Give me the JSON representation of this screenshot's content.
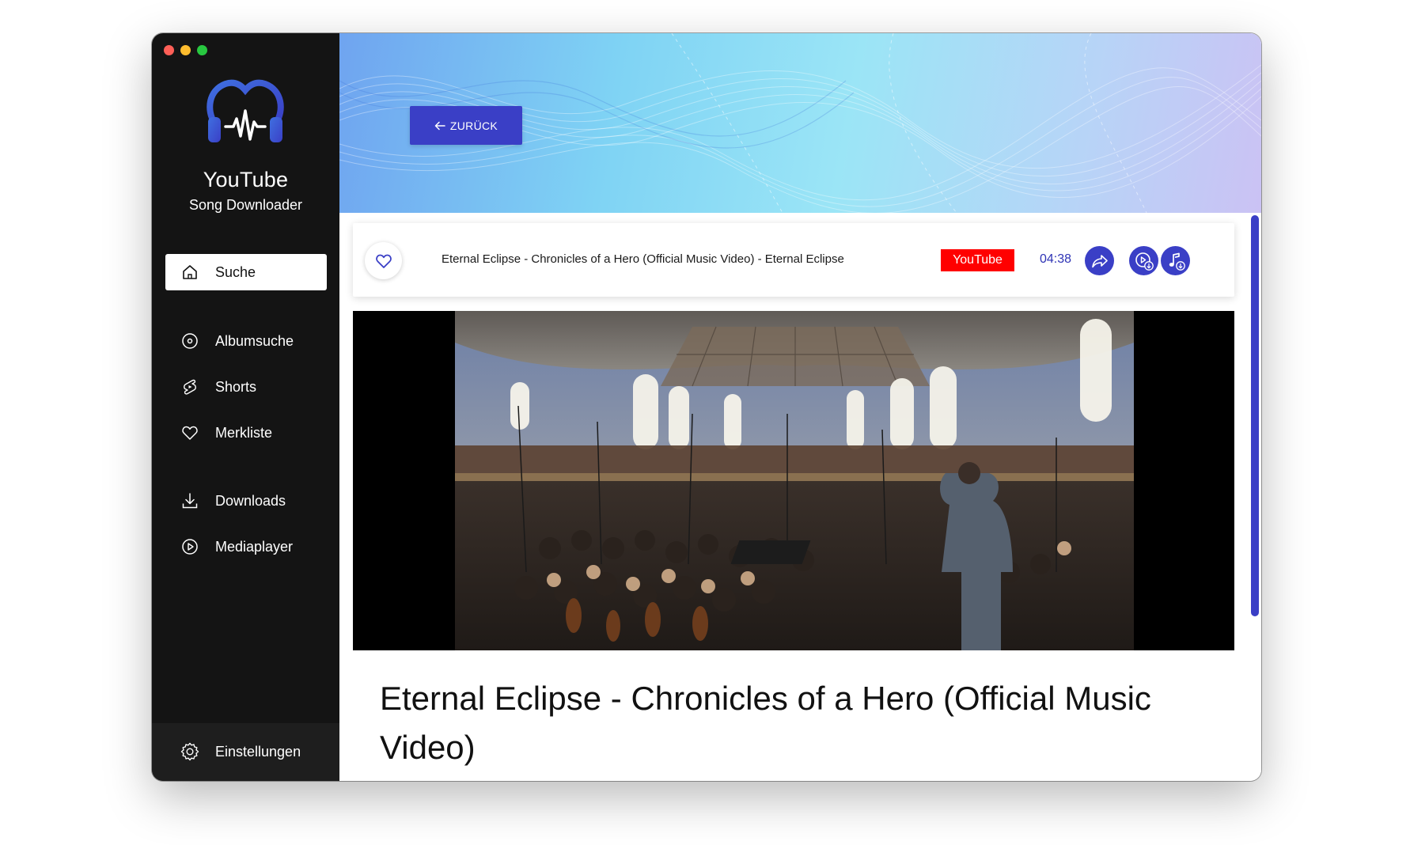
{
  "app": {
    "title": "YouTube",
    "subtitle": "Song Downloader"
  },
  "colors": {
    "accent": "#3a3fc6",
    "source_badge": "#ff0000",
    "sidebar_bg": "#141414"
  },
  "sidebar": {
    "items": [
      {
        "label": "Suche",
        "icon": "home-icon",
        "active": true
      },
      {
        "label": "Albumsuche",
        "icon": "disc-icon",
        "active": false
      },
      {
        "label": "Shorts",
        "icon": "shorts-icon",
        "active": false
      },
      {
        "label": "Merkliste",
        "icon": "heart-icon",
        "active": false
      },
      {
        "label": "Downloads",
        "icon": "download-icon",
        "active": false
      },
      {
        "label": "Mediaplayer",
        "icon": "play-circle-icon",
        "active": false
      }
    ],
    "settings": {
      "label": "Einstellungen",
      "icon": "gear-icon"
    }
  },
  "header": {
    "back_label": "ZURÜCK"
  },
  "track": {
    "title": "Eternal Eclipse - Chronicles of a Hero (Official Music Video) - Eternal Eclipse",
    "source": "YouTube",
    "duration": "04:38",
    "favorite": false,
    "actions": [
      "share-icon",
      "video-download-icon",
      "audio-download-icon"
    ]
  },
  "video": {
    "headline": "Eternal Eclipse - Chronicles of a Hero (Official Music Video)"
  }
}
